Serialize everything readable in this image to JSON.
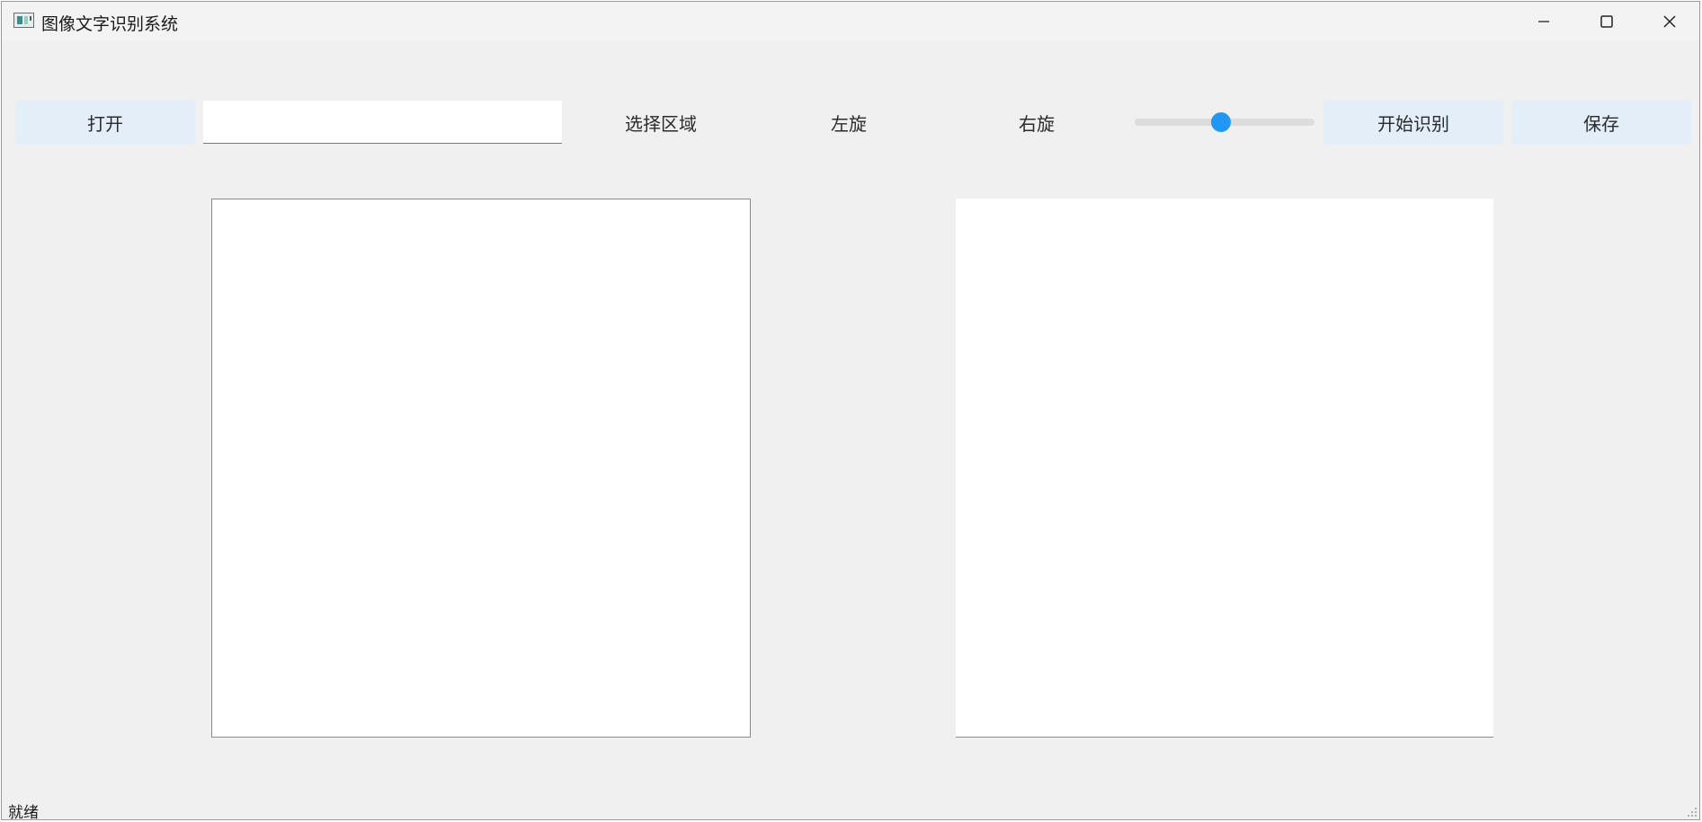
{
  "window": {
    "title": "图像文字识别系统",
    "icons": {
      "app": "app-icon",
      "minimize": "minimize-icon",
      "maximize": "maximize-icon",
      "close": "close-icon"
    }
  },
  "toolbar": {
    "open_label": "打开",
    "path_value": "",
    "select_region_label": "选择区域",
    "rotate_left_label": "左旋",
    "rotate_right_label": "右旋",
    "slider_value": 0.48,
    "start_label": "开始识别",
    "save_label": "保存"
  },
  "status": {
    "text": "就绪"
  },
  "colors": {
    "accent": "#2196f3",
    "button_bg": "#e3eef8",
    "window_bg": "#f0f0f0",
    "panel_bg": "#ffffff"
  }
}
